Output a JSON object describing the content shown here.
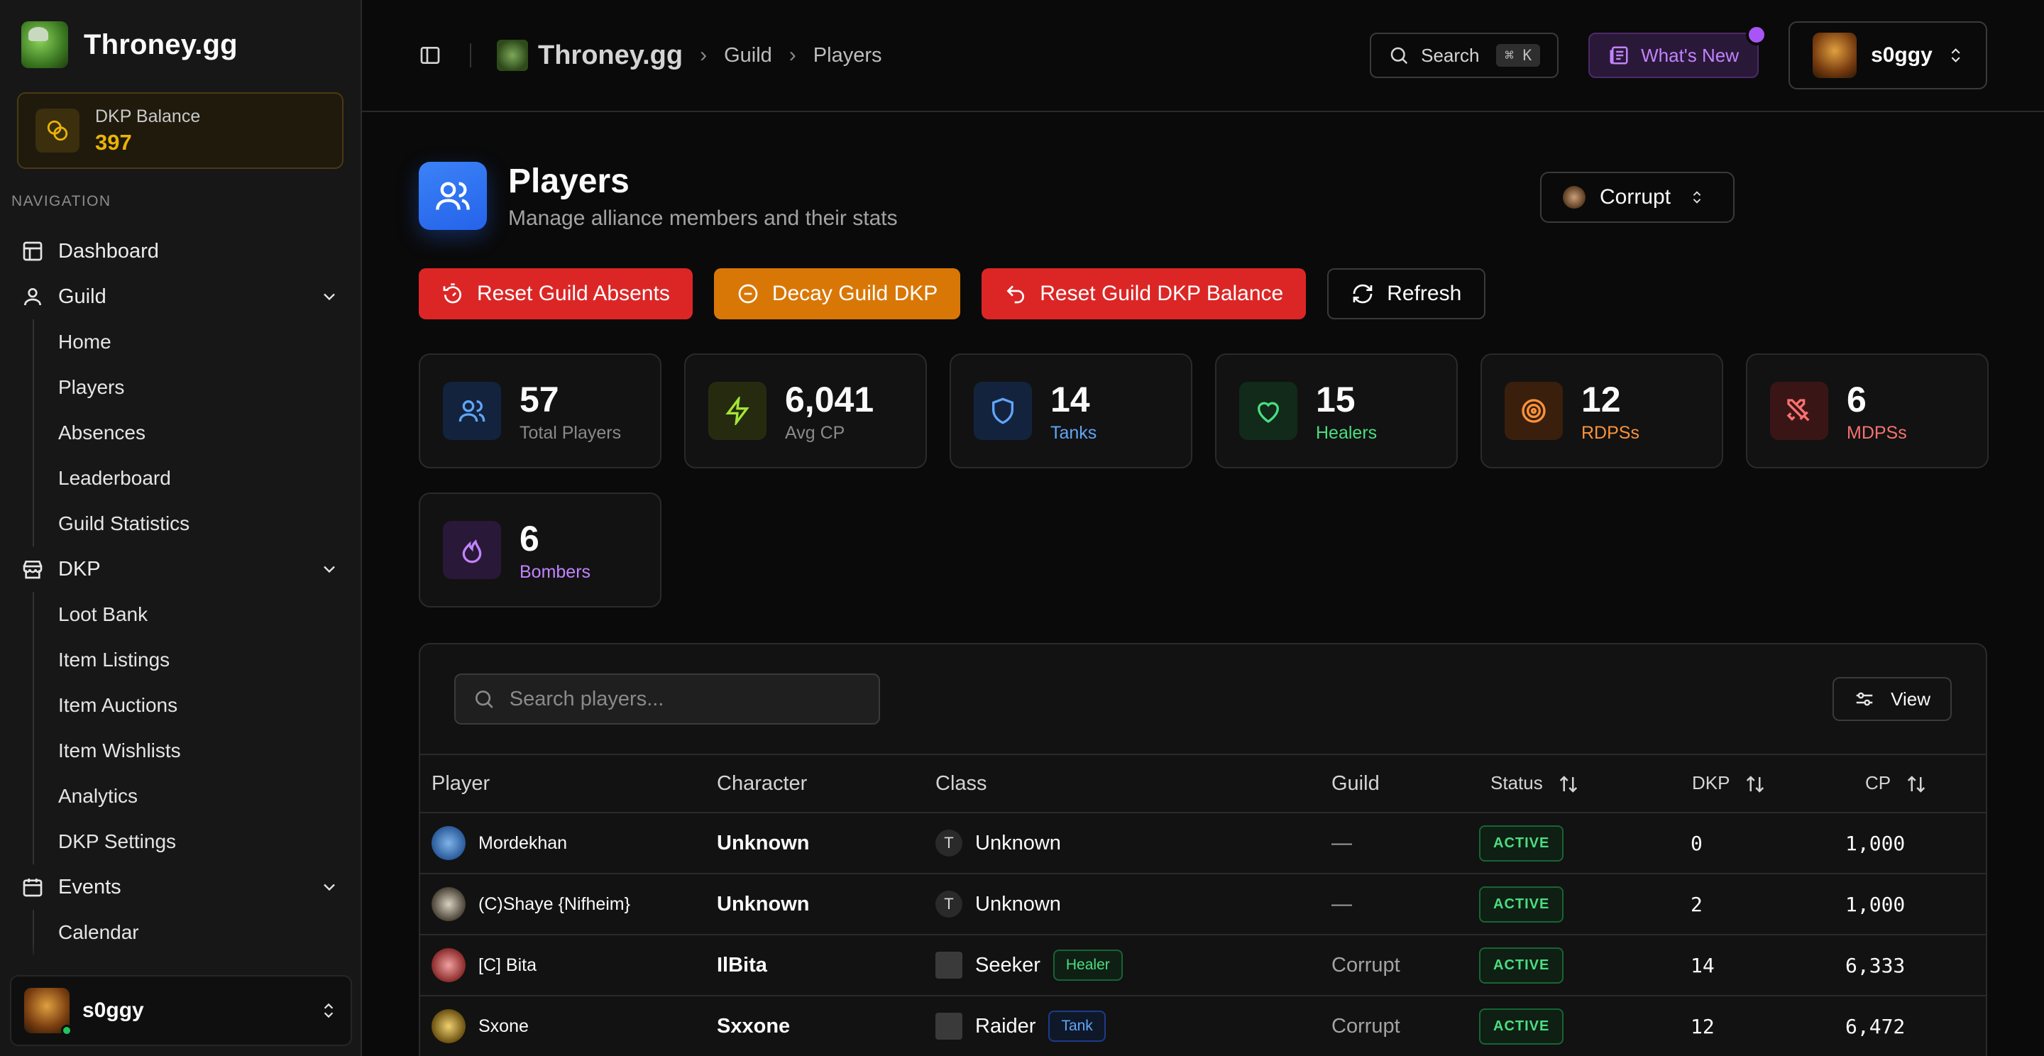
{
  "app": {
    "name": "Throney.gg"
  },
  "sidebar": {
    "dkp_balance": {
      "label": "DKP Balance",
      "value": "397"
    },
    "nav_title": "NAVIGATION",
    "dashboard": "Dashboard",
    "guild": {
      "label": "Guild",
      "items": [
        "Home",
        "Players",
        "Absences",
        "Leaderboard",
        "Guild Statistics"
      ]
    },
    "dkp": {
      "label": "DKP",
      "items": [
        "Loot Bank",
        "Item Listings",
        "Item Auctions",
        "Item Wishlists",
        "Analytics",
        "DKP Settings"
      ]
    },
    "events": {
      "label": "Events",
      "items": [
        "Calendar"
      ]
    },
    "user": {
      "name": "s0ggy"
    }
  },
  "topbar": {
    "breadcrumb": [
      "Throney.gg",
      "Guild",
      "Players"
    ],
    "search_label": "Search",
    "search_kbd": "⌘ K",
    "whats_new": "What's New",
    "user": "s0ggy"
  },
  "page": {
    "title": "Players",
    "subtitle": "Manage alliance members and their stats",
    "guild_select": "Corrupt"
  },
  "actions": {
    "reset_absents": "Reset Guild Absents",
    "decay_dkp": "Decay Guild DKP",
    "reset_balance": "Reset Guild DKP Balance",
    "refresh": "Refresh"
  },
  "stats": [
    {
      "value": "57",
      "label": "Total Players",
      "color": "#60a5fa"
    },
    {
      "value": "6,041",
      "label": "Avg CP",
      "color": "#a3e635"
    },
    {
      "value": "14",
      "label": "Tanks",
      "color": "#60a5fa"
    },
    {
      "value": "15",
      "label": "Healers",
      "color": "#4ade80"
    },
    {
      "value": "12",
      "label": "RDPSs",
      "color": "#fb923c"
    },
    {
      "value": "6",
      "label": "MDPSs",
      "color": "#f87171"
    },
    {
      "value": "6",
      "label": "Bombers",
      "color": "#c084fc"
    }
  ],
  "table": {
    "search_placeholder": "Search players...",
    "view_label": "View",
    "columns": [
      "Player",
      "Character",
      "Class",
      "Guild",
      "Status",
      "DKP",
      "CP"
    ],
    "rows": [
      {
        "player": "Mordekhan",
        "character": "Unknown",
        "class_icon": "T",
        "class": "Unknown",
        "role": "",
        "guild": "—",
        "status": "ACTIVE",
        "dkp": "0",
        "cp": "1,000"
      },
      {
        "player": "(C)Shaye {Nifheim}",
        "character": "Unknown",
        "class_icon": "T",
        "class": "Unknown",
        "role": "",
        "guild": "—",
        "status": "ACTIVE",
        "dkp": "2",
        "cp": "1,000"
      },
      {
        "player": "[C] Bita",
        "character": "IlBita",
        "class_icon": "",
        "class": "Seeker",
        "role": "Healer",
        "guild": "Corrupt",
        "status": "ACTIVE",
        "dkp": "14",
        "cp": "6,333"
      },
      {
        "player": "Sxone",
        "character": "Sxxone",
        "class_icon": "",
        "class": "Raider",
        "role": "Tank",
        "guild": "Corrupt",
        "status": "ACTIVE",
        "dkp": "12",
        "cp": "6,472"
      }
    ]
  }
}
